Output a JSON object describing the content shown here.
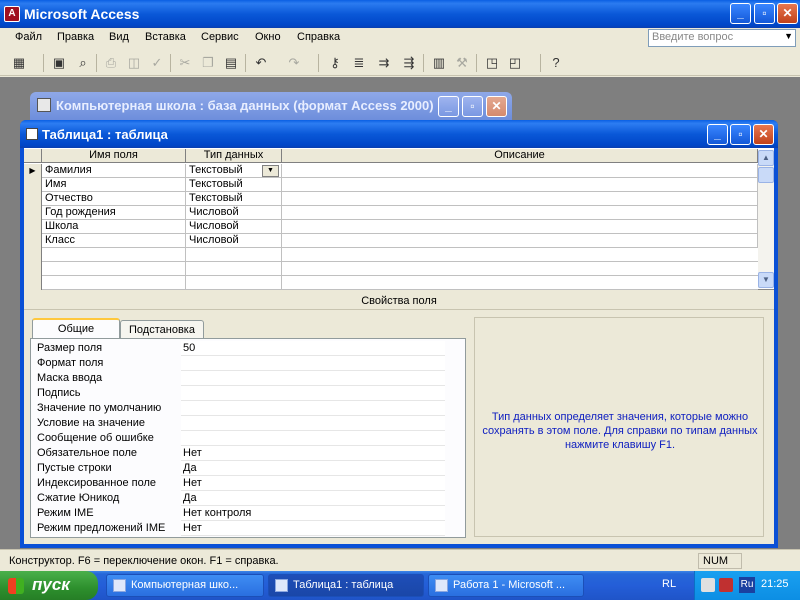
{
  "app": {
    "title": "Microsoft Access",
    "icon_letter": "A",
    "controls": {
      "minimize": "_",
      "maximize": "▫",
      "close": "✕"
    }
  },
  "menu": {
    "items": [
      "Файл",
      "Правка",
      "Вид",
      "Вставка",
      "Сервис",
      "Окно",
      "Справка"
    ],
    "ask_placeholder": "Введите вопрос",
    "ask_dropdown": "▼"
  },
  "toolbar": {
    "icons": [
      "view-icon",
      "save-icon",
      "search-icon",
      "print-icon",
      "preview-icon",
      "spell-icon",
      "cut-icon",
      "copy-icon",
      "paste-icon",
      "undo-icon",
      "redo-icon",
      "key-icon",
      "indexes-icon",
      "insert-rows-icon",
      "delete-rows-icon",
      "properties-icon",
      "build-icon",
      "database-window-icon",
      "new-object-icon",
      "help-icon"
    ]
  },
  "db_window": {
    "title": "Компьютерная школа : база данных (формат Access 2000)"
  },
  "table_window": {
    "title": "Таблица1 : таблица",
    "columns": [
      "Имя поля",
      "Тип данных",
      "Описание"
    ],
    "rows": [
      {
        "name": "Фамилия",
        "type": "Текстовый",
        "desc": ""
      },
      {
        "name": "Имя",
        "type": "Текстовый",
        "desc": ""
      },
      {
        "name": "Отчество",
        "type": "Текстовый",
        "desc": ""
      },
      {
        "name": "Год рождения",
        "type": "Числовой",
        "desc": ""
      },
      {
        "name": "Школа",
        "type": "Числовой",
        "desc": ""
      },
      {
        "name": "Класс",
        "type": "Числовой",
        "desc": ""
      }
    ],
    "properties_title": "Свойства поля",
    "tabs": [
      "Общие",
      "Подстановка"
    ],
    "properties": [
      {
        "label": "Размер поля",
        "value": "50"
      },
      {
        "label": "Формат поля",
        "value": ""
      },
      {
        "label": "Маска ввода",
        "value": ""
      },
      {
        "label": "Подпись",
        "value": ""
      },
      {
        "label": "Значение по умолчанию",
        "value": ""
      },
      {
        "label": "Условие на значение",
        "value": ""
      },
      {
        "label": "Сообщение об ошибке",
        "value": ""
      },
      {
        "label": "Обязательное поле",
        "value": "Нет"
      },
      {
        "label": "Пустые строки",
        "value": "Да"
      },
      {
        "label": "Индексированное поле",
        "value": "Нет"
      },
      {
        "label": "Сжатие Юникод",
        "value": "Да"
      },
      {
        "label": "Режим IME",
        "value": "Нет контроля"
      },
      {
        "label": "Режим предложений IME",
        "value": "Нет"
      }
    ],
    "help_text": "Тип данных определяет значения, которые можно сохранять в этом поле.  Для справки по типам данных нажмите клавишу F1."
  },
  "status": {
    "text": "Конструктор.  F6 = переключение окон.  F1 = справка.",
    "num": "NUM"
  },
  "taskbar": {
    "start": "пуск",
    "tasks": [
      "Компьютерная шко...",
      "Таблица1 : таблица",
      "Работа 1 - Microsoft ..."
    ],
    "lang": "RL",
    "tray_lang": "Ru",
    "clock": "21:25"
  }
}
